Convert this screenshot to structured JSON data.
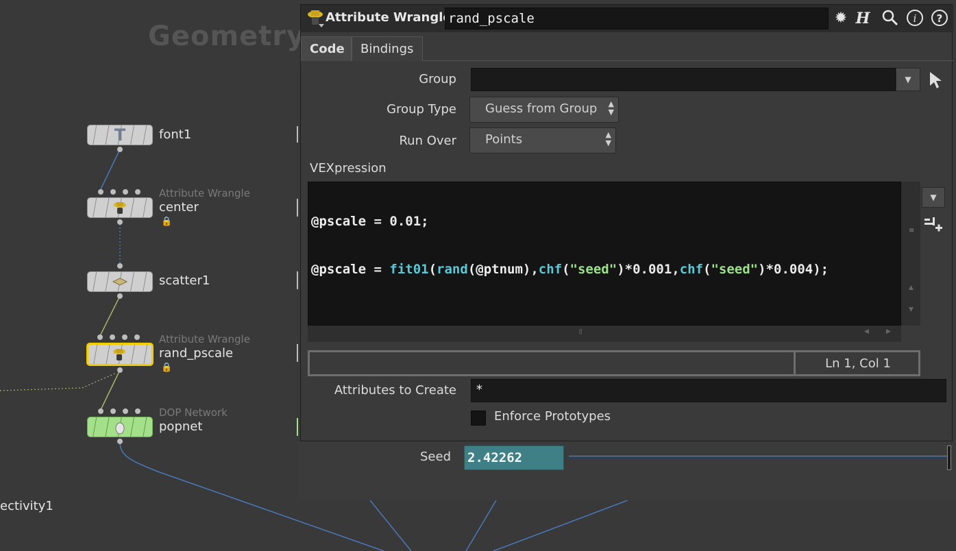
{
  "network": {
    "title": "Geometry",
    "edge_label_left": "ectivity1",
    "nodes": [
      {
        "name": "font1",
        "type": "",
        "icon": "T",
        "selected": false,
        "locked": false
      },
      {
        "name": "center",
        "type": "Attribute Wrangle",
        "icon": "wrangle",
        "selected": false,
        "locked": true
      },
      {
        "name": "scatter1",
        "type": "",
        "icon": "scatter",
        "selected": false,
        "locked": false
      },
      {
        "name": "rand_pscale",
        "type": "Attribute Wrangle",
        "icon": "wrangle",
        "selected": true,
        "locked": true
      },
      {
        "name": "popnet",
        "type": "DOP Network",
        "icon": "pop",
        "selected": false,
        "locked": false
      }
    ]
  },
  "panel": {
    "node_type": "Attribute Wrangle",
    "node_name": "rand_pscale",
    "header_icons": [
      "gear-icon",
      "houdini-h-icon",
      "search-icon",
      "info-icon",
      "help-icon"
    ],
    "tabs": [
      {
        "label": "Code",
        "active": true
      },
      {
        "label": "Bindings",
        "active": false
      }
    ],
    "params": {
      "group_label": "Group",
      "group_value": "",
      "group_type_label": "Group Type",
      "group_type_value": "Guess from Group",
      "run_over_label": "Run Over",
      "run_over_value": "Points",
      "vexpression_label": "VEXpression",
      "code_lines": [
        "@pscale = 0.01;",
        "@pscale = fit01(rand(@ptnum),chf(\"seed\")*0.001,chf(\"seed\")*0.004);"
      ],
      "cursor_position": "Ln 1, Col 1",
      "attributes_label": "Attributes to Create",
      "attributes_value": "*",
      "enforce_label": "Enforce Prototypes",
      "enforce_checked": false
    },
    "seed": {
      "label": "Seed",
      "value": "2.42262"
    }
  },
  "colors": {
    "selected_node": "#f0cc00",
    "dop_node": "#a4e08a",
    "seed_field": "#3f7f86"
  }
}
